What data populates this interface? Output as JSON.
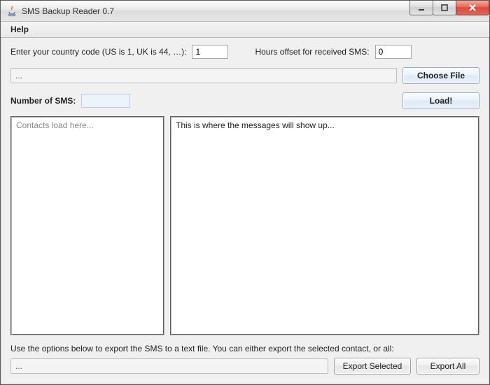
{
  "window": {
    "title": "SMS Backup Reader 0.7"
  },
  "menu": {
    "help": "Help"
  },
  "settings": {
    "country_code_label": "Enter your country code (US is 1, UK is 44, …):",
    "country_code_value": "1",
    "hours_offset_label": "Hours offset for received SMS:",
    "hours_offset_value": "0"
  },
  "file": {
    "path_display": "...",
    "choose_label": "Choose File",
    "load_label": "Load!"
  },
  "counts": {
    "label": "Number of SMS:",
    "value": ""
  },
  "panes": {
    "contacts_placeholder": "Contacts load here...",
    "messages_placeholder": "This is where the messages will show up..."
  },
  "export": {
    "note": "Use the options below to export the SMS to a text file. You can either export the selected contact, or all:",
    "path_display": "...",
    "selected_label": "Export Selected",
    "all_label": "Export All"
  }
}
